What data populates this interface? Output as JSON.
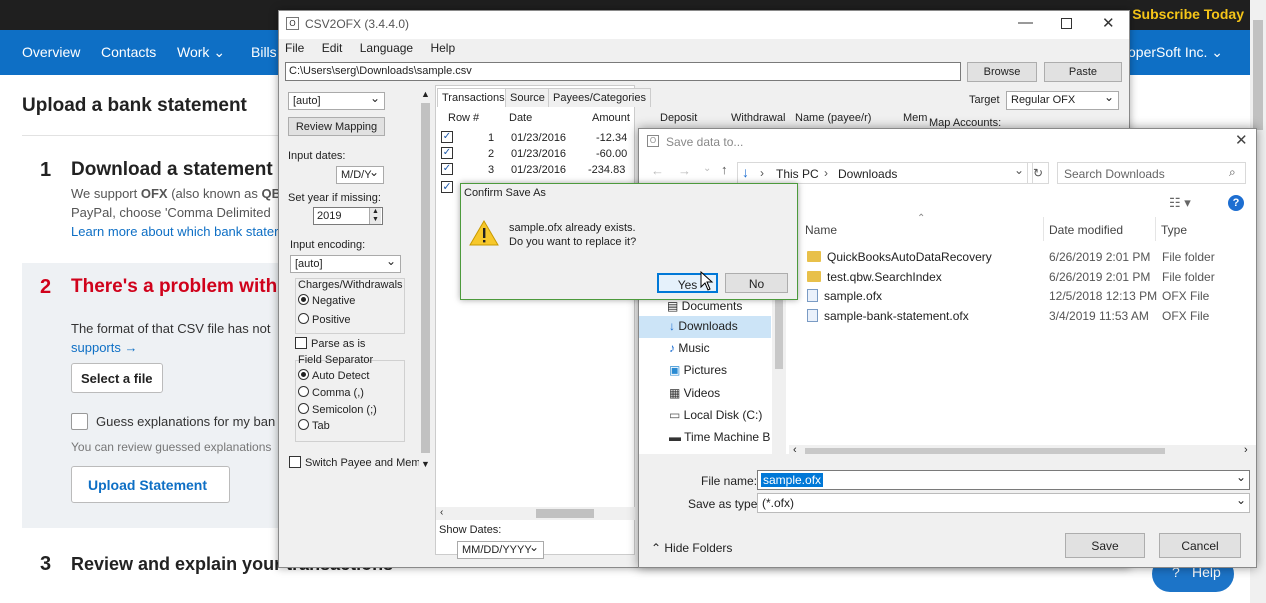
{
  "web": {
    "subscribe": "Subscribe Today",
    "nav": [
      "Overview",
      "Contacts",
      "Work",
      "Bills"
    ],
    "company": "operSoft Inc.",
    "page_title": "Upload a bank statement",
    "step1_num": "1",
    "step1_title": "Download a statement f",
    "step1_line1a": "We support ",
    "step1_line1b": "OFX",
    "step1_line1c": " (also known as ",
    "step1_line1d": "QB",
    "step1_line2": "PayPal, choose 'Comma Delimited",
    "step1_link": "Learn more about which bank stater",
    "step2_num": "2",
    "step2_title": "There's a problem with",
    "step2_line1": "The format of that CSV file has not",
    "step2_link": "supports →",
    "select_file": "Select a file",
    "guess_label": "Guess explanations for my ban",
    "guess_sub": "You can review guessed explanations",
    "upload_btn": "Upload Statement",
    "step3_num": "3",
    "step3_title": "Review and explain you",
    "step3_title2": "r transactions",
    "help": "Help"
  },
  "app": {
    "title": "CSV2OFX (3.4.4.0)",
    "menu": [
      "File",
      "Edit",
      "Language",
      "Help"
    ],
    "path": "C:\\Users\\serg\\Downloads\\sample.csv",
    "browse": "Browse",
    "paste": "Paste",
    "mapping_select": "[auto]",
    "review_mapping": "Review Mapping",
    "input_dates_label": "Input dates:",
    "date_format": "M/D/Y",
    "set_year_label": "Set year if missing:",
    "year": "2019",
    "encoding_label": "Input encoding:",
    "encoding": "[auto]",
    "charges_label": "Charges/Withdrawals",
    "negative": "Negative",
    "positive": "Positive",
    "parse_as_is": "Parse as is",
    "field_sep_label": "Field Separator",
    "auto_detect": "Auto Detect",
    "comma": "Comma (,)",
    "semicolon": "Semicolon (;)",
    "tab": "Tab",
    "switch_payee": "Switch Payee and Memo",
    "tabs": [
      "Transactions",
      "Source",
      "Payees/Categories"
    ],
    "columns": [
      "Row #",
      "Date",
      "Amount",
      "Deposit",
      "Withdrawal",
      "Name (payee/r)",
      "Mem"
    ],
    "rows": [
      {
        "row": "1",
        "date": "01/23/2016",
        "amount": "-12.34"
      },
      {
        "row": "2",
        "date": "01/23/2016",
        "amount": "-60.00"
      },
      {
        "row": "3",
        "date": "01/23/2016",
        "amount": "-234.83"
      }
    ],
    "target_label": "Target",
    "target": "Regular OFX",
    "map_accounts": "Map Accounts:",
    "show_dates_label": "Show Dates:",
    "show_dates": "MM/DD/YYYY"
  },
  "save": {
    "title": "Save data to...",
    "breadcrumb": [
      "This PC",
      "Downloads"
    ],
    "search_placeholder": "Search Downloads",
    "nav": [
      "Documents",
      "Downloads",
      "Music",
      "Pictures",
      "Videos",
      "Local Disk (C:)",
      "Time Machine B"
    ],
    "col_name": "Name",
    "col_date": "Date modified",
    "col_type": "Type",
    "files": [
      {
        "name": "QuickBooksAutoDataRecovery",
        "date": "6/26/2019 2:01 PM",
        "type": "File folder",
        "icon": "folder"
      },
      {
        "name": "test.qbw.SearchIndex",
        "date": "6/26/2019 2:01 PM",
        "type": "File folder",
        "icon": "folder"
      },
      {
        "name": "sample.ofx",
        "date": "12/5/2018 12:13 PM",
        "type": "OFX File",
        "icon": "file"
      },
      {
        "name": "sample-bank-statement.ofx",
        "date": "3/4/2019 11:53 AM",
        "type": "OFX File",
        "icon": "file"
      }
    ],
    "filename_label": "File name:",
    "filename": "sample.ofx",
    "type_label": "Save as type:",
    "type": "(*.ofx)",
    "hide_folders": "Hide Folders",
    "save_btn": "Save",
    "cancel_btn": "Cancel"
  },
  "confirm": {
    "title": "Confirm Save As",
    "line1": "sample.ofx already exists.",
    "line2": "Do you want to replace it?",
    "yes": "Yes",
    "no": "No"
  }
}
